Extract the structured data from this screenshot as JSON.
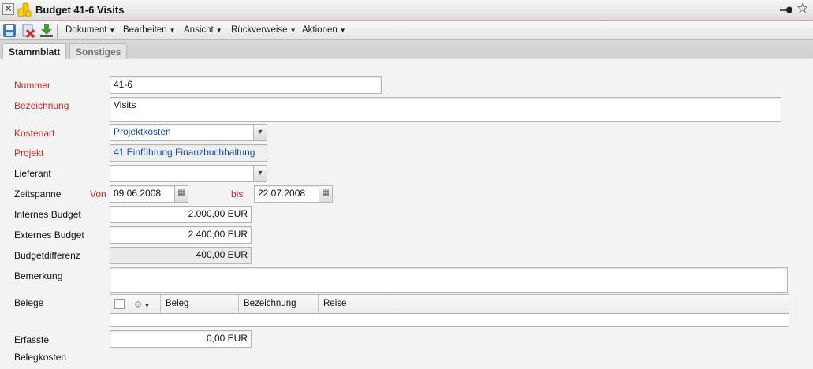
{
  "window": {
    "title": "Budget 41-6 Visits"
  },
  "toolbar": {
    "menus": [
      "Dokument",
      "Bearbeiten",
      "Ansicht",
      "Rückverweise",
      "Aktionen"
    ]
  },
  "tabs": [
    "Stammblatt",
    "Sonstiges"
  ],
  "form": {
    "nummer": {
      "label": "Nummer",
      "value": "41-6"
    },
    "bezeichnung": {
      "label": "Bezeichnung",
      "value": "Visits"
    },
    "kostenart": {
      "label": "Kostenart",
      "value": "Projektkosten"
    },
    "projekt": {
      "label": "Projekt",
      "value": "41 Einführung Finanzbuchhaltung"
    },
    "lieferant": {
      "label": "Lieferant",
      "value": ""
    },
    "zeitspanne": {
      "label": "Zeitspanne",
      "von_label": "Von",
      "von": "09.06.2008",
      "bis_label": "bis",
      "bis": "22.07.2008"
    },
    "internes_budget": {
      "label": "Internes Budget",
      "value": "2.000,00 EUR"
    },
    "externes_budget": {
      "label": "Externes Budget",
      "value": "2.400,00 EUR"
    },
    "budgetdifferenz": {
      "label": "Budgetdifferenz",
      "value": "400,00 EUR"
    },
    "bemerkung": {
      "label": "Bemerkung",
      "value": ""
    },
    "belege": {
      "label": "Belege",
      "columns": [
        "Beleg",
        "Bezeichnung",
        "Reise"
      ]
    },
    "erfasste": {
      "label_line1": "Erfasste",
      "label_line2": "Belegkosten",
      "value": "0,00 EUR"
    }
  },
  "colors": {
    "required_label": "#d0281e",
    "link": "#1847c8"
  }
}
